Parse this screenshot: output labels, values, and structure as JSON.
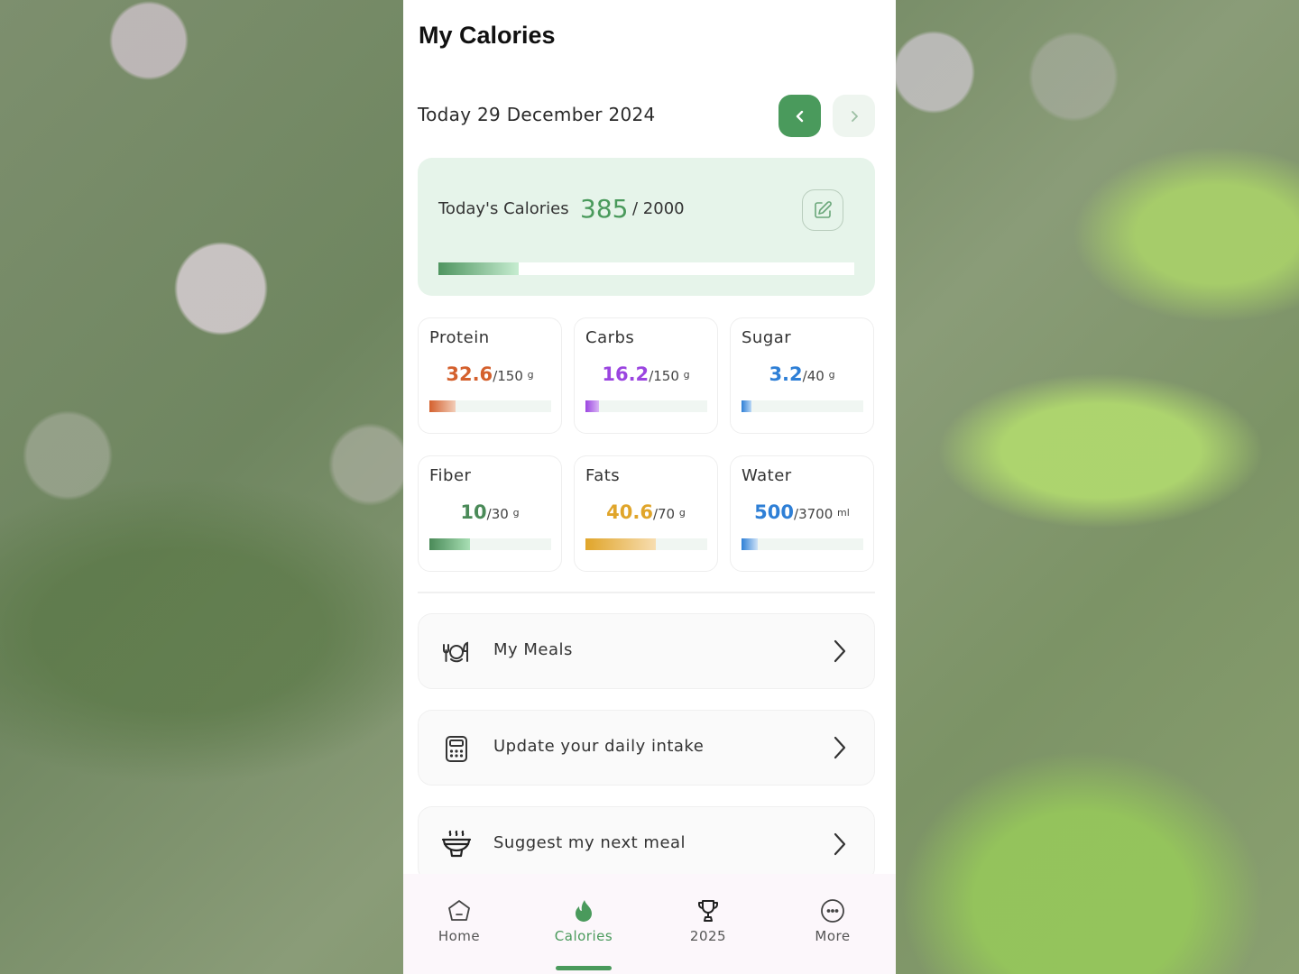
{
  "header": {
    "title": "My Calories",
    "date": "Today 29 December 2024",
    "prev_icon": "chevron-left-icon",
    "next_icon": "chevron-right-icon"
  },
  "calories": {
    "label": "Today's Calories",
    "value": "385",
    "target": "/ 2000",
    "progress_fraction": 0.1925,
    "edit_icon": "edit-icon",
    "accent": "#4a9a5c"
  },
  "nutrients": [
    {
      "name": "Protein",
      "value": "32.6",
      "target": "/150",
      "unit": "g",
      "fraction": 0.217,
      "color": "#d4602d",
      "fill_from": "#d4602d",
      "fill_to": "#f2cdb8"
    },
    {
      "name": "Carbs",
      "value": "16.2",
      "target": "/150",
      "unit": "g",
      "fraction": 0.108,
      "color": "#9b45e0",
      "fill_from": "#9b45e0",
      "fill_to": "#d9b5f5"
    },
    {
      "name": "Sugar",
      "value": "3.2",
      "target": "/40",
      "unit": "g",
      "fraction": 0.08,
      "color": "#2e7fd6",
      "fill_from": "#2e7fd6",
      "fill_to": "#b9d7f5"
    },
    {
      "name": "Fiber",
      "value": "10",
      "target": "/30",
      "unit": "g",
      "fraction": 0.333,
      "color": "#4a8a58",
      "fill_from": "#4a8a58",
      "fill_to": "#a8dfb4"
    },
    {
      "name": "Fats",
      "value": "40.6",
      "target": "/70",
      "unit": "g",
      "fraction": 0.58,
      "color": "#e0a52a",
      "fill_from": "#e0a52a",
      "fill_to": "#f7ddb0"
    },
    {
      "name": "Water",
      "value": "500",
      "target": "/3700",
      "unit": "ml",
      "fraction": 0.135,
      "color": "#2e7fd6",
      "fill_from": "#2e7fd6",
      "fill_to": "#cfe3f7"
    }
  ],
  "menu": [
    {
      "label": "My Meals",
      "icon": "plate-cutlery-icon"
    },
    {
      "label": "Update your daily intake",
      "icon": "calculator-icon"
    },
    {
      "label": "Suggest my next meal",
      "icon": "hot-bowl-icon"
    }
  ],
  "tabs": [
    {
      "label": "Home",
      "icon": "home-icon",
      "active": false
    },
    {
      "label": "Calories",
      "icon": "flame-icon",
      "active": true
    },
    {
      "label": "2025",
      "icon": "trophy-icon",
      "active": false
    },
    {
      "label": "More",
      "icon": "more-icon",
      "active": false
    }
  ]
}
